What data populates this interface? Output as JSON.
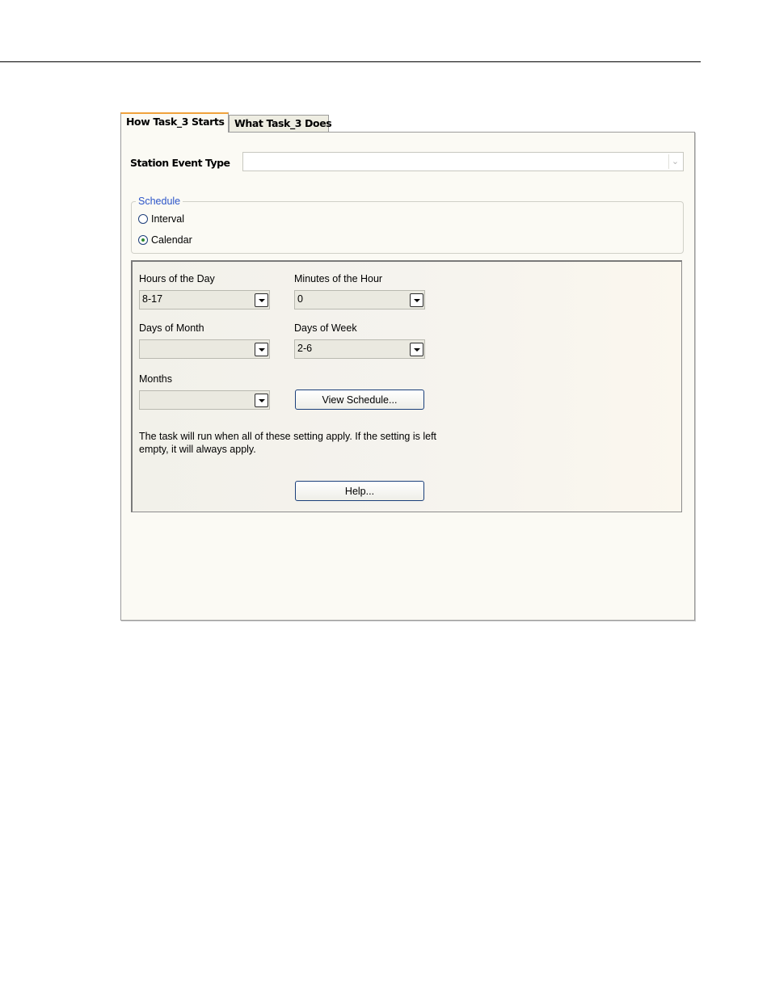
{
  "tabs": [
    {
      "label": "How Task_3 Starts",
      "active": true
    },
    {
      "label": "What Task_3 Does",
      "active": false
    }
  ],
  "station_event": {
    "label": "Station Event Type",
    "value": ""
  },
  "schedule": {
    "legend": "Schedule",
    "options": [
      {
        "label": "Interval",
        "checked": false
      },
      {
        "label": "Calendar",
        "checked": true
      }
    ]
  },
  "calendar": {
    "hours_of_day": {
      "label": "Hours of the Day",
      "value": "8-17"
    },
    "minutes_of_hour": {
      "label": "Minutes of the Hour",
      "value": "0"
    },
    "days_of_month": {
      "label": "Days of Month",
      "value": ""
    },
    "days_of_week": {
      "label": "Days of Week",
      "value": "2-6"
    },
    "months": {
      "label": "Months",
      "value": ""
    },
    "view_schedule_button": "View Schedule...",
    "note": "The task will run when all of these setting apply. If the setting is left empty, it will always apply.",
    "help_button": "Help..."
  },
  "colors": {
    "active_tab_accent": "#f0a23c",
    "schedule_legend": "#2b54c8",
    "radio_checked_dot": "#2f8a2f"
  }
}
